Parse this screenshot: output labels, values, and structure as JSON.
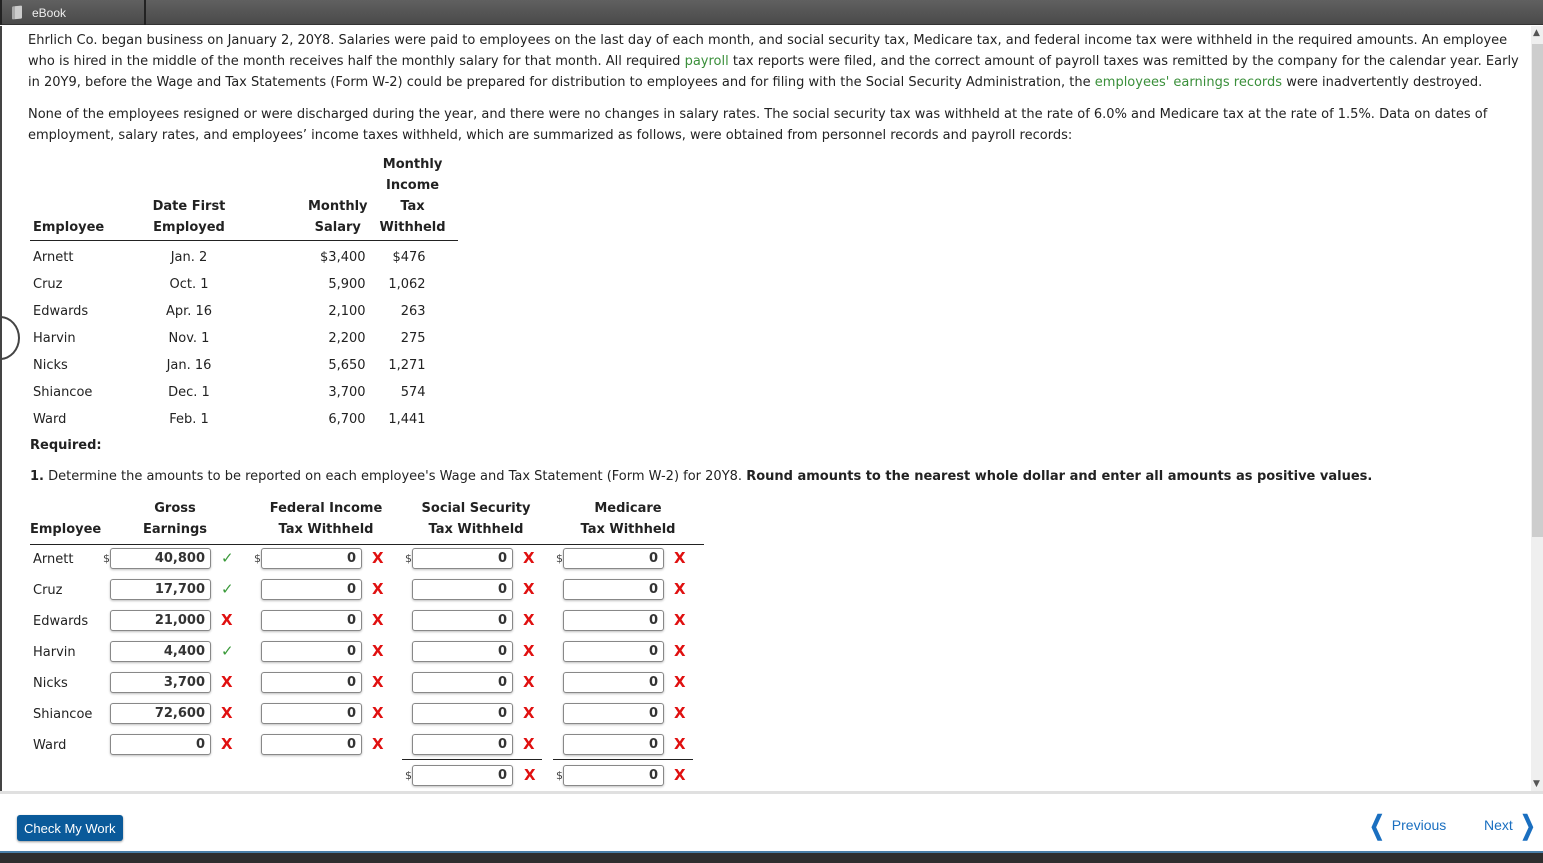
{
  "topbar": {
    "tab_label": "eBook"
  },
  "intro": {
    "p1_a": "Ehrlich Co. began business on January 2, 20Y8. Salaries were paid to employees on the last day of each month, and social security tax, Medicare tax, and federal income tax were withheld in the required amounts. An employee who is hired in the middle of the month receives half the monthly salary for that month. All required ",
    "p1_link1": "payroll",
    "p1_b": " tax reports were filed, and the correct amount of payroll taxes was remitted by the company for the calendar year. Early in 20Y9, before the Wage and Tax Statements (Form W-2) could be prepared for distribution to employees and for filing with the Social Security Administration, the ",
    "p1_link2": "employees' earnings records",
    "p1_c": " were inadvertently destroyed.",
    "p2": "None of the employees resigned or were discharged during the year, and there were no changes in salary rates. The social security tax was withheld at the rate of 6.0% and Medicare tax at the rate of 1.5%. Data on dates of employment, salary rates, and employees’ income taxes withheld, which are summarized as follows, were obtained from personnel records and payroll records:"
  },
  "data_table": {
    "headers": {
      "employee": "Employee",
      "date_1": "Date First",
      "date_2": "Employed",
      "salary_1": "Monthly",
      "salary_2": "Salary",
      "tax_1": "Monthly",
      "tax_2": "Income",
      "tax_3": "Tax",
      "tax_4": "Withheld"
    },
    "rows": [
      {
        "employee": "Arnett",
        "date": "Jan. 2",
        "salary": "$3,400",
        "tax": "$476"
      },
      {
        "employee": "Cruz",
        "date": "Oct. 1",
        "salary": "5,900",
        "tax": "1,062"
      },
      {
        "employee": "Edwards",
        "date": "Apr. 16",
        "salary": "2,100",
        "tax": "263"
      },
      {
        "employee": "Harvin",
        "date": "Nov. 1",
        "salary": "2,200",
        "tax": "275"
      },
      {
        "employee": "Nicks",
        "date": "Jan. 16",
        "salary": "5,650",
        "tax": "1,271"
      },
      {
        "employee": "Shiancoe",
        "date": "Dec. 1",
        "salary": "3,700",
        "tax": "574"
      },
      {
        "employee": "Ward",
        "date": "Feb. 1",
        "salary": "6,700",
        "tax": "1,441"
      }
    ]
  },
  "required": {
    "label": "Required:",
    "num": "1.",
    "text": " Determine the amounts to be reported on each employee's Wage and Tax Statement (Form W-2) for 20Y8. ",
    "bold": "Round amounts to the nearest whole dollar and enter all amounts as positive values."
  },
  "answer": {
    "headers": {
      "employee": "Employee",
      "gross_1": "Gross",
      "gross_2": "Earnings",
      "fed_1": "Federal Income",
      "fed_2": "Tax Withheld",
      "ss_1": "Social Security",
      "ss_2": "Tax Withheld",
      "med_1": "Medicare",
      "med_2": "Tax Withheld"
    },
    "currency": "$",
    "rows": [
      {
        "employee": "Arnett",
        "gross": "40,800",
        "gross_ok": "✓",
        "fed": "0",
        "fed_ok": "X",
        "ss": "0",
        "ss_ok": "X",
        "med": "0",
        "med_ok": "X"
      },
      {
        "employee": "Cruz",
        "gross": "17,700",
        "gross_ok": "✓",
        "fed": "0",
        "fed_ok": "X",
        "ss": "0",
        "ss_ok": "X",
        "med": "0",
        "med_ok": "X"
      },
      {
        "employee": "Edwards",
        "gross": "21,000",
        "gross_ok": "X",
        "fed": "0",
        "fed_ok": "X",
        "ss": "0",
        "ss_ok": "X",
        "med": "0",
        "med_ok": "X"
      },
      {
        "employee": "Harvin",
        "gross": "4,400",
        "gross_ok": "✓",
        "fed": "0",
        "fed_ok": "X",
        "ss": "0",
        "ss_ok": "X",
        "med": "0",
        "med_ok": "X"
      },
      {
        "employee": "Nicks",
        "gross": "3,700",
        "gross_ok": "X",
        "fed": "0",
        "fed_ok": "X",
        "ss": "0",
        "ss_ok": "X",
        "med": "0",
        "med_ok": "X"
      },
      {
        "employee": "Shiancoe",
        "gross": "72,600",
        "gross_ok": "X",
        "fed": "0",
        "fed_ok": "X",
        "ss": "0",
        "ss_ok": "X",
        "med": "0",
        "med_ok": "X"
      },
      {
        "employee": "Ward",
        "gross": "0",
        "gross_ok": "X",
        "fed": "0",
        "fed_ok": "X",
        "ss": "0",
        "ss_ok": "X",
        "med": "0",
        "med_ok": "X"
      }
    ],
    "totals": {
      "ss": "0",
      "ss_ok": "X",
      "med": "0",
      "med_ok": "X"
    },
    "colors": {
      "correct": "#3a9a3a",
      "incorrect": "#e01010"
    }
  },
  "footer": {
    "check_label": "Check My Work",
    "prev_label": "Previous",
    "next_label": "Next"
  }
}
